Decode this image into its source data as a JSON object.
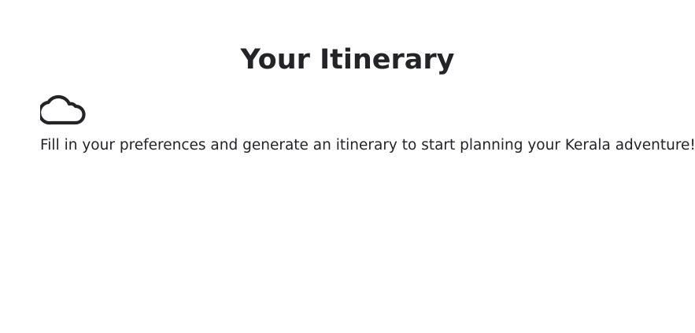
{
  "itinerary": {
    "title": "Your Itinerary",
    "empty_icon": "cloud-icon",
    "empty_message": "Fill in your preferences and generate an itinerary to start planning your Kerala adventure!"
  },
  "colors": {
    "text": "#222428",
    "background": "#ffffff"
  }
}
